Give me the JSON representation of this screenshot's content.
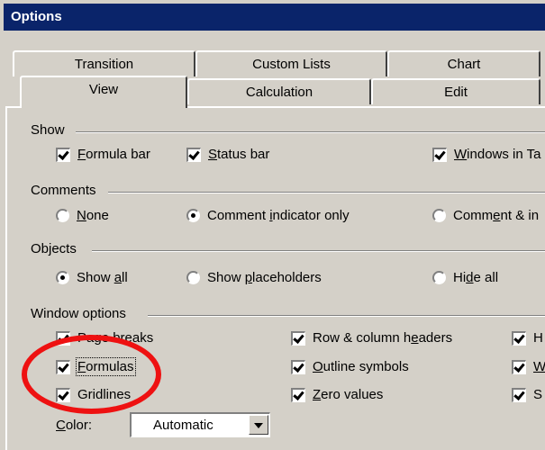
{
  "dialog": {
    "title": "Options"
  },
  "tabs": {
    "back_row": [
      "Transition",
      "Custom Lists",
      "Chart"
    ],
    "front_row": [
      "View",
      "Calculation",
      "Edit"
    ]
  },
  "groups": {
    "show": {
      "label": "Show",
      "formula_bar": {
        "label": "Formula bar",
        "mnemonic": "F",
        "rest": "ormula bar",
        "checked": true
      },
      "status_bar": {
        "label": "Status bar",
        "mnemonic": "S",
        "rest": "tatus bar",
        "checked": true
      },
      "windows_in_taskbar": {
        "label": "Windows in Ta",
        "mnemonic": "W",
        "rest": "indows in Ta",
        "checked": true
      }
    },
    "comments": {
      "label": "Comments",
      "none": {
        "label": "None",
        "mnemonic": "N",
        "rest": "one",
        "selected": false
      },
      "indicator_only": {
        "pre": "Comment ",
        "mnemonic": "i",
        "post": "ndicator only",
        "selected": true
      },
      "comment_and": {
        "pre": "Comm",
        "mnemonic": "e",
        "post": "nt & in",
        "selected": false
      }
    },
    "objects": {
      "label": "Objects",
      "show_all": {
        "pre": "Show ",
        "mnemonic": "a",
        "post": "ll",
        "selected": true
      },
      "show_placeholders": {
        "pre": "Show ",
        "mnemonic": "p",
        "post": "laceholders",
        "selected": false
      },
      "hide_all": {
        "pre": "Hi",
        "mnemonic": "d",
        "post": "e all",
        "selected": false
      }
    },
    "window_options": {
      "label": "Window options",
      "page_breaks": {
        "label": "Page breaks",
        "checked": true
      },
      "formulas": {
        "pre": "",
        "mnemonic": "F",
        "post": "ormulas",
        "checked": true
      },
      "gridlines": {
        "label": "Gridlines",
        "checked": true
      },
      "row_col_headers": {
        "pre": "Row & column h",
        "mnemonic": "e",
        "post": "aders",
        "checked": true
      },
      "outline_symbols": {
        "pre": "",
        "mnemonic": "O",
        "post": "utline symbols",
        "checked": true
      },
      "zero_values": {
        "pre": "",
        "mnemonic": "Z",
        "post": "ero values",
        "checked": true
      },
      "col3_a": {
        "label": "H",
        "checked": true
      },
      "col3_b": {
        "label": "W",
        "checked": true
      },
      "col3_c": {
        "label": "S",
        "checked": true
      },
      "color_label": {
        "pre": "",
        "mnemonic": "C",
        "post": "olor:"
      },
      "color_value": "Automatic"
    }
  },
  "colors": {
    "title_bar": "#0a246a",
    "dialog_bg": "#d4d0c8",
    "annotation": "#ee1111"
  }
}
